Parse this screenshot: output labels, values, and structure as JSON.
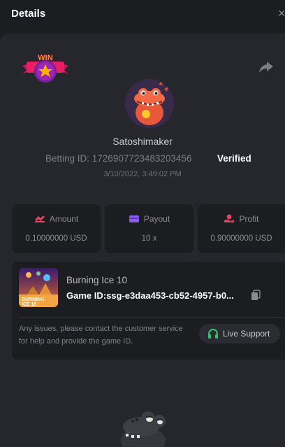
{
  "header": {
    "title": "Details",
    "close_glyph": "×"
  },
  "bet": {
    "username": "Satoshimaker",
    "betting_id": "Betting ID: 1726907723483203456",
    "verified": "Verified",
    "datetime": "3/10/2022, 3:49:02 PM",
    "badge_text": "WIN"
  },
  "stats": [
    {
      "label": "Amount",
      "value": "0.10000000 USD",
      "icon": "amount-icon",
      "color": "#e2455f"
    },
    {
      "label": "Payout",
      "value": "10 x",
      "icon": "payout-card-icon",
      "color": "#8b5cf6"
    },
    {
      "label": "Profit",
      "value": "0.90000000 USD",
      "icon": "profit-icon",
      "color": "#e2455f"
    }
  ],
  "game": {
    "name": "Burning Ice 10",
    "game_id": "Game ID:ssg-e3daa453-cb52-4957-b0...",
    "thumb_line1": "BURNING",
    "thumb_line2": "ICE 10",
    "issue_text": "Any issues, please contact the customer service for help and provide the game ID.",
    "support_label": "Live Support"
  },
  "colors": {
    "accent_green": "#32c36b",
    "panel": "#25272c",
    "card": "#1c1d21"
  }
}
